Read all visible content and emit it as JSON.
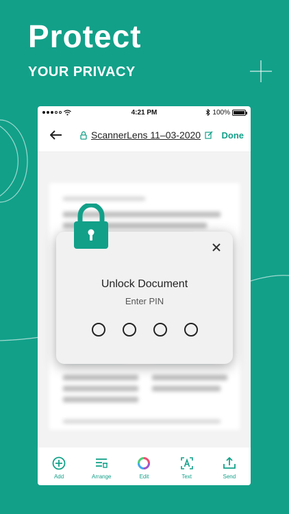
{
  "hero": {
    "title": "Protect",
    "subtitle": "YOUR PRIVACY"
  },
  "status_bar": {
    "time": "4:21 PM",
    "battery": "100%",
    "battery_level": 1.0
  },
  "nav": {
    "document_title": "ScannerLens 11–03-2020",
    "done_label": "Done"
  },
  "dialog": {
    "title": "Unlock Document",
    "subtitle": "Enter PIN",
    "pin_length": 4
  },
  "toolbar": {
    "items": [
      {
        "label": "Add",
        "icon": "add-circle-icon"
      },
      {
        "label": "Arrange",
        "icon": "arrange-icon"
      },
      {
        "label": "Edit",
        "icon": "color-wheel-icon"
      },
      {
        "label": "Text",
        "icon": "text-scan-icon"
      },
      {
        "label": "Send",
        "icon": "share-icon"
      }
    ]
  },
  "colors": {
    "brand": "#12A089",
    "dialog_bg": "#f1f1f1"
  }
}
